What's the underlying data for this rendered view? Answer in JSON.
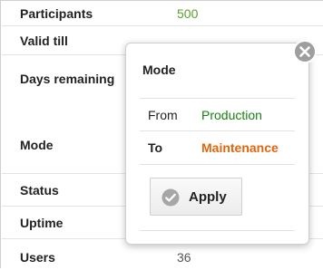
{
  "details": {
    "rows": [
      {
        "label": "Participants",
        "value": "500"
      },
      {
        "label": "Valid till",
        "value": ""
      },
      {
        "label": "Days remaining",
        "value": ""
      },
      {
        "label": "Mode",
        "value": ""
      },
      {
        "label": "Status",
        "value": ""
      },
      {
        "label": "Uptime",
        "value": ""
      },
      {
        "label": "Users",
        "value": "36"
      }
    ]
  },
  "popover": {
    "title": "Mode",
    "from_label": "From",
    "from_value": "Production",
    "to_label": "To",
    "to_value": "Maintenance",
    "apply_label": "Apply",
    "close_icon": "close-circle-icon",
    "apply_icon": "check-circle-icon"
  },
  "colors": {
    "participants_value": "#5aa02c",
    "from_value": "#1a7f12",
    "to_value": "#e0650b"
  }
}
